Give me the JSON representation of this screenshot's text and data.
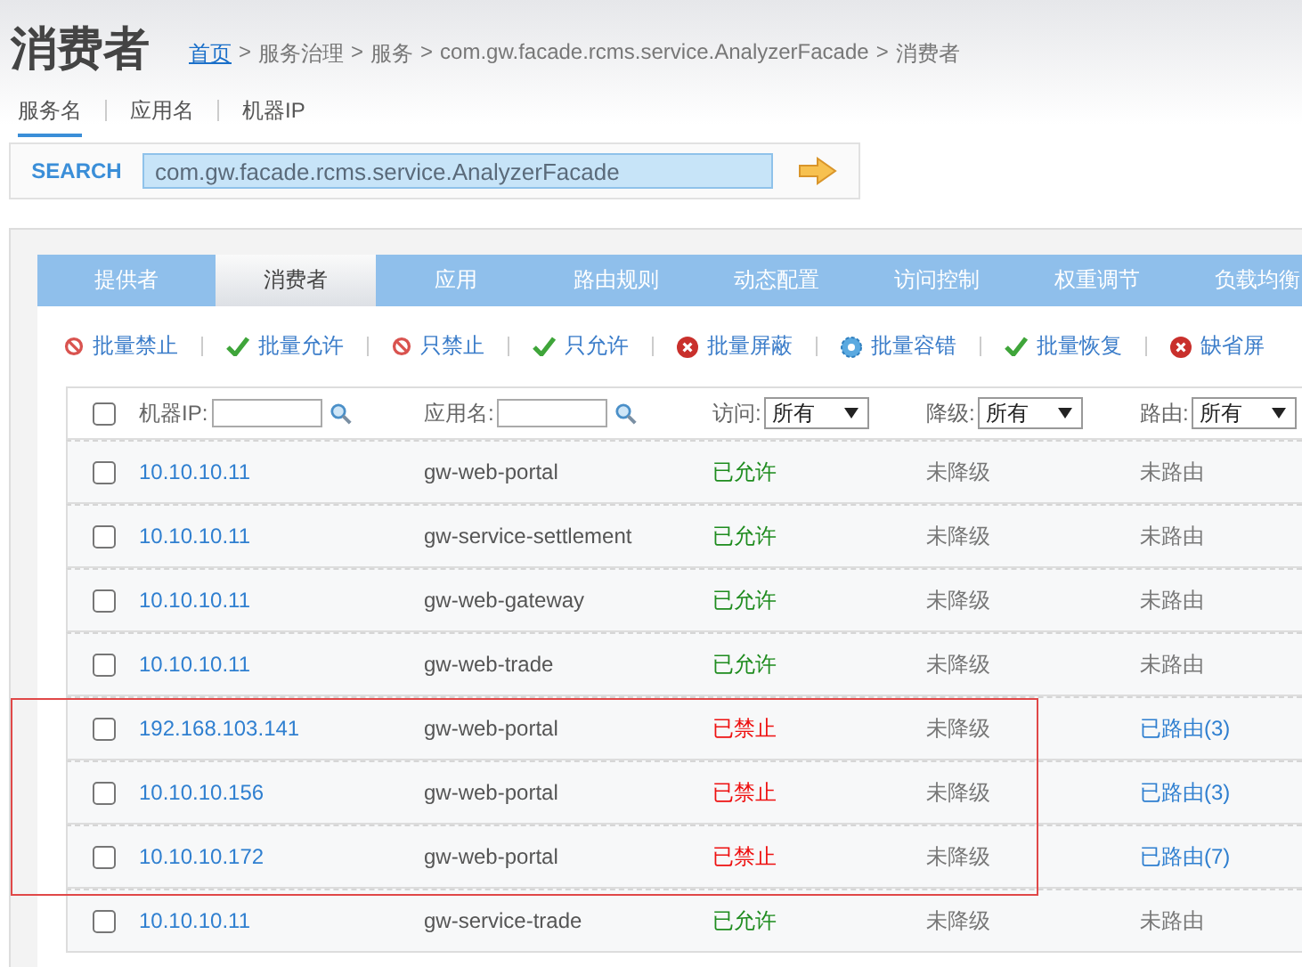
{
  "page_title": "消费者",
  "breadcrumb": [
    {
      "label": "首页",
      "link": true
    },
    {
      "label": "服务治理",
      "link": false
    },
    {
      "label": "服务",
      "link": false
    },
    {
      "label": "com.gw.facade.rcms.service.AnalyzerFacade",
      "link": false
    },
    {
      "label": "消费者",
      "link": false
    }
  ],
  "breadcrumb_separator": ">",
  "search_modes": [
    {
      "label": "服务名",
      "selected": true
    },
    {
      "label": "应用名",
      "selected": false
    },
    {
      "label": "机器IP",
      "selected": false
    }
  ],
  "search": {
    "label": "SEARCH",
    "value": "com.gw.facade.rcms.service.AnalyzerFacade"
  },
  "tabs": [
    {
      "label": "提供者",
      "selected": false
    },
    {
      "label": "消费者",
      "selected": true
    },
    {
      "label": "应用",
      "selected": false
    },
    {
      "label": "路由规则",
      "selected": false
    },
    {
      "label": "动态配置",
      "selected": false
    },
    {
      "label": "访问控制",
      "selected": false
    },
    {
      "label": "权重调节",
      "selected": false
    },
    {
      "label": "负载均衡",
      "selected": false
    }
  ],
  "actions": [
    {
      "label": "批量禁止",
      "kind": "ban"
    },
    {
      "label": "批量允许",
      "kind": "check"
    },
    {
      "label": "只禁止",
      "kind": "ban"
    },
    {
      "label": "只允许",
      "kind": "check"
    },
    {
      "label": "批量屏蔽",
      "kind": "cross"
    },
    {
      "label": "批量容错",
      "kind": "gear"
    },
    {
      "label": "批量恢复",
      "kind": "check"
    },
    {
      "label": "缺省屏",
      "kind": "cross"
    }
  ],
  "filters": {
    "checked": false,
    "ip_label": "机器IP:",
    "app_label": "应用名:",
    "access_label": "访问:",
    "access_value": "所有",
    "degrade_label": "降级:",
    "degrade_value": "所有",
    "route_label": "路由:",
    "route_value": "所有"
  },
  "rows": [
    {
      "checked": false,
      "ip": "10.10.10.11",
      "app": "gw-web-portal",
      "access": "已允许",
      "allowed": true,
      "degrade": "未降级",
      "route": "未路由",
      "routed": false,
      "highlighted": false
    },
    {
      "checked": false,
      "ip": "10.10.10.11",
      "app": "gw-service-settlement",
      "access": "已允许",
      "allowed": true,
      "degrade": "未降级",
      "route": "未路由",
      "routed": false,
      "highlighted": false
    },
    {
      "checked": false,
      "ip": "10.10.10.11",
      "app": "gw-web-gateway",
      "access": "已允许",
      "allowed": true,
      "degrade": "未降级",
      "route": "未路由",
      "routed": false,
      "highlighted": false
    },
    {
      "checked": false,
      "ip": "10.10.10.11",
      "app": "gw-web-trade",
      "access": "已允许",
      "allowed": true,
      "degrade": "未降级",
      "route": "未路由",
      "routed": false,
      "highlighted": false
    },
    {
      "checked": false,
      "ip": "192.168.103.141",
      "app": "gw-web-portal",
      "access": "已禁止",
      "allowed": false,
      "degrade": "未降级",
      "route": "已路由(3)",
      "routed": true,
      "highlighted": true
    },
    {
      "checked": false,
      "ip": "10.10.10.156",
      "app": "gw-web-portal",
      "access": "已禁止",
      "allowed": false,
      "degrade": "未降级",
      "route": "已路由(3)",
      "routed": true,
      "highlighted": true
    },
    {
      "checked": false,
      "ip": "10.10.10.172",
      "app": "gw-web-portal",
      "access": "已禁止",
      "allowed": false,
      "degrade": "未降级",
      "route": "已路由(7)",
      "routed": true,
      "highlighted": true
    },
    {
      "checked": false,
      "ip": "10.10.10.11",
      "app": "gw-service-trade",
      "access": "已允许",
      "allowed": true,
      "degrade": "未降级",
      "route": "未路由",
      "routed": false,
      "highlighted": false
    }
  ]
}
